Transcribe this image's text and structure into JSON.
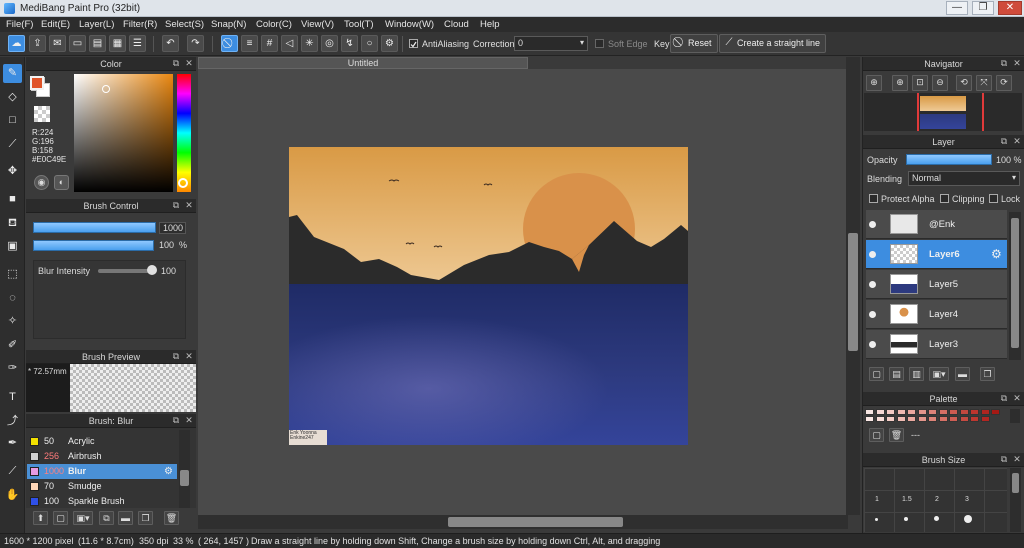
{
  "window": {
    "title": "MediBang Paint Pro (32bit)",
    "minimize": "—",
    "maximize": "❐",
    "close": "✕"
  },
  "menu": [
    "File(F)",
    "Edit(E)",
    "Layer(L)",
    "Filter(R)",
    "Select(S)",
    "Snap(N)",
    "Color(C)",
    "View(V)",
    "Tool(T)",
    "Window(W)",
    "Cloud",
    "Help"
  ],
  "toolbar": {
    "antialiasing": "AntiAliasing",
    "correction_label": "Correction",
    "correction_value": "0",
    "soft_edge": "Soft Edge",
    "key_label": "Key",
    "reset": "Reset",
    "straight_line": "Create a straight line"
  },
  "document": {
    "tab_title": "Untitled",
    "signature": "Enk Yoonna Enkine247"
  },
  "color_panel": {
    "title": "Color",
    "r": "R:224",
    "g": "G:196",
    "b": "B:158",
    "hex": "#E0C49E",
    "main_color": "#E0C49E",
    "accent": "#E0542A"
  },
  "brush_control": {
    "title": "Brush Control",
    "size": "1000",
    "opacity": "100",
    "percent": "%",
    "blur_label": "Blur Intensity",
    "blur_value": "100"
  },
  "brush_preview": {
    "title": "Brush Preview",
    "size": "* 72.57mm"
  },
  "brush_list": {
    "title": "Brush: Blur",
    "items": [
      {
        "size": "50",
        "name": "Acrylic",
        "color": "#f2e000"
      },
      {
        "size": "256",
        "name": "Airbrush",
        "color": "#cfcfcf"
      },
      {
        "size": "1000",
        "name": "Blur",
        "color": "#e79be3"
      },
      {
        "size": "70",
        "name": "Smudge",
        "color": "#ffd7b8"
      },
      {
        "size": "100",
        "name": "Sparkle Brush",
        "color": "#2f50e8"
      }
    ]
  },
  "navigator": {
    "title": "Navigator"
  },
  "layer_panel": {
    "title": "Layer",
    "opacity_label": "Opacity",
    "opacity_value": "100 %",
    "blending_label": "Blending",
    "blending_value": "Normal",
    "protect_alpha": "Protect Alpha",
    "clipping": "Clipping",
    "lock": "Lock",
    "layers": [
      "@Enk",
      "Layer6",
      "Layer5",
      "Layer4",
      "Layer3"
    ]
  },
  "palette": {
    "title": "Palette",
    "placeholder": "---",
    "colors": [
      "#f7e6e3",
      "#f5d8d4",
      "#f2cac4",
      "#efbab2",
      "#eaa89f",
      "#e3958b",
      "#dc8278",
      "#d56f65",
      "#cd5b51",
      "#c4483f",
      "#bb352e",
      "#b02520",
      "#a51914",
      "#fbe9e6",
      "#f8ddd8",
      "#f4cdc6",
      "#f0bcb3",
      "#ebaaa0",
      "#e5978c",
      "#de8478",
      "#d77166",
      "#cf5e54",
      "#c64b42",
      "#bd3830",
      "#b32622"
    ]
  },
  "brush_size": {
    "title": "Brush Size",
    "sizes": [
      "1",
      "1.5",
      "2",
      "3"
    ]
  },
  "status": {
    "pixels": "1600 * 1200 pixel",
    "physical": "(11.6 * 8.7cm)",
    "dpi": "350 dpi",
    "zoom": "33 %",
    "coords": "( 264, 1457 )",
    "hint": "Draw a straight line by holding down Shift, Change a brush size by holding down Ctrl, Alt, and dragging"
  }
}
